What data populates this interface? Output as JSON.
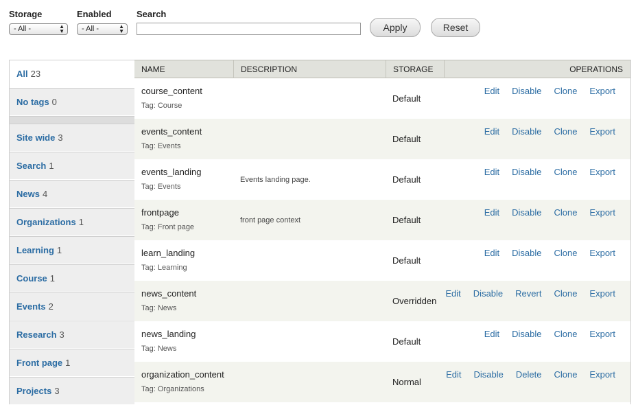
{
  "filters": {
    "storage_label": "Storage",
    "storage_value": "- All -",
    "enabled_label": "Enabled",
    "enabled_value": "- All -",
    "search_label": "Search",
    "search_value": "",
    "apply_label": "Apply",
    "reset_label": "Reset"
  },
  "sidebar": {
    "items": [
      {
        "label": "All",
        "count": "23"
      },
      {
        "label": "No tags",
        "count": "0"
      },
      {
        "label": "Site wide",
        "count": "3"
      },
      {
        "label": "Search",
        "count": "1"
      },
      {
        "label": "News",
        "count": "4"
      },
      {
        "label": "Organizations",
        "count": "1"
      },
      {
        "label": "Learning",
        "count": "1"
      },
      {
        "label": "Course",
        "count": "1"
      },
      {
        "label": "Events",
        "count": "2"
      },
      {
        "label": "Research",
        "count": "3"
      },
      {
        "label": "Front page",
        "count": "1"
      },
      {
        "label": "Projects",
        "count": "3"
      }
    ]
  },
  "table": {
    "headers": {
      "name": "NAME",
      "description": "DESCRIPTION",
      "storage": "STORAGE",
      "operations": "OPERATIONS"
    },
    "rows": [
      {
        "name": "course_content",
        "tag": "Tag: Course",
        "description": "",
        "storage": "Default",
        "ops": [
          "Edit",
          "Disable",
          "Clone",
          "Export"
        ]
      },
      {
        "name": "events_content",
        "tag": "Tag: Events",
        "description": "",
        "storage": "Default",
        "ops": [
          "Edit",
          "Disable",
          "Clone",
          "Export"
        ]
      },
      {
        "name": "events_landing",
        "tag": "Tag: Events",
        "description": "Events landing page.",
        "storage": "Default",
        "ops": [
          "Edit",
          "Disable",
          "Clone",
          "Export"
        ]
      },
      {
        "name": "frontpage",
        "tag": "Tag: Front page",
        "description": "front page context",
        "storage": "Default",
        "ops": [
          "Edit",
          "Disable",
          "Clone",
          "Export"
        ]
      },
      {
        "name": "learn_landing",
        "tag": "Tag: Learning",
        "description": "",
        "storage": "Default",
        "ops": [
          "Edit",
          "Disable",
          "Clone",
          "Export"
        ]
      },
      {
        "name": "news_content",
        "tag": "Tag: News",
        "description": "",
        "storage": "Overridden",
        "ops": [
          "Edit",
          "Disable",
          "Revert",
          "Clone",
          "Export"
        ]
      },
      {
        "name": "news_landing",
        "tag": "Tag: News",
        "description": "",
        "storage": "Default",
        "ops": [
          "Edit",
          "Disable",
          "Clone",
          "Export"
        ]
      },
      {
        "name": "organization_content",
        "tag": "Tag: Organizations",
        "description": "",
        "storage": "Normal",
        "ops": [
          "Edit",
          "Disable",
          "Delete",
          "Clone",
          "Export"
        ]
      }
    ]
  }
}
